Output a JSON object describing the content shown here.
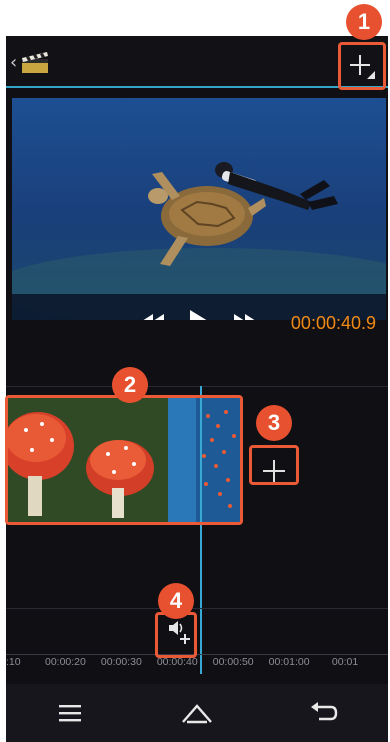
{
  "player": {
    "timecode": "00:00:40.9"
  },
  "timeline": {
    "ticks": [
      ":10",
      "00:00:20",
      "00:00:30",
      "00:00:40",
      "00:00:50",
      "00:01:00",
      "00:01"
    ]
  },
  "callouts": [
    "1",
    "2",
    "3",
    "4"
  ],
  "colors": {
    "accent": "#34a7c9",
    "callout": "#e8512f",
    "timecode": "#f08a16"
  }
}
